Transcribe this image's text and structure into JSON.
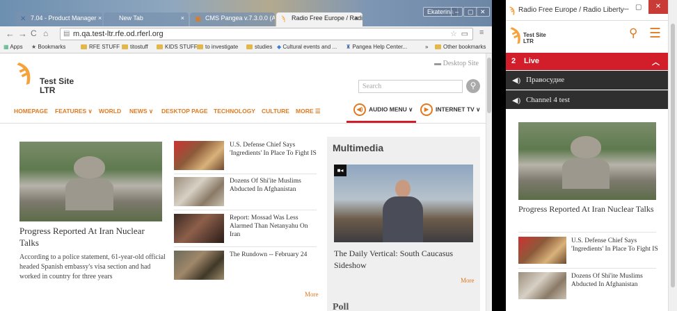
{
  "browser": {
    "tabs": [
      {
        "label": "7.04 - Product Manager ×",
        "icon": "x-icon"
      },
      {
        "label": "New Tab",
        "icon": ""
      },
      {
        "label": "CMS Pangea v.7.3.0.0 (A...",
        "icon": "cms-icon"
      },
      {
        "label": "Radio Free Europe / Radio",
        "icon": "rferl-icon"
      }
    ],
    "user_badge": "Ekaterina",
    "url": "m.qa.test-ltr.rfe.od.rferl.org",
    "bookmarks": [
      "Apps",
      "Bookmarks",
      "RFE STUFF",
      "titostuff",
      "KIDS STUFF",
      "to investigate",
      "studies",
      "Cultural events and ...",
      "Pangea Help Center...",
      "»",
      "Other bookmarks"
    ]
  },
  "site": {
    "logo_line1": "Test Site",
    "logo_line2": "LTR",
    "desktop_site": "Desktop Site",
    "search_placeholder": "Search",
    "nav": [
      "HOMEPAGE",
      "FEATURES ∨",
      "WORLD",
      "NEWS ∨",
      "DESKTOP PAGE",
      "TECHNOLOGY",
      "CULTURE",
      "MORE ☰"
    ],
    "audio_menu": "AUDIO MENU ∨",
    "internet_tv": "INTERNET TV ∨",
    "accent": "#e2791e",
    "red": "#d21e2b"
  },
  "main": {
    "lead_title": "Progress Reported At Iran Nuclear Talks",
    "lead_text": "According to a police statement, 61-year-old official headed Spanish embassy's visa section and had worked in country for three years",
    "stories": [
      "U.S. Defense Chief Says 'Ingredients' In Place To Fight IS",
      "Dozens Of Shi'ite Muslims Abducted In Afghanistan",
      "Report: Mossad Was Less Alarmed Than Netanyahu On Iran",
      "The Rundown -- February 24"
    ],
    "more_label": "More",
    "multimedia_heading": "Multimedia",
    "video_title": "The Daily Vertical: South Caucasus Sideshow",
    "poll_heading": "Poll"
  },
  "mobile": {
    "window_title": "Radio Free Europe / Radio Liberty",
    "logo_line1": "Test Site",
    "logo_line2": "LTR",
    "live_count": "2",
    "live_label": "Live",
    "channels": [
      "Правосудие",
      "Channel 4 test"
    ],
    "lead_title": "Progress Reported At Iran Nuclear Talks",
    "stories": [
      "U.S. Defense Chief Says 'Ingredients' In Place To Fight IS",
      "Dozens Of Shi'ite Muslims Abducted In Afghanistan"
    ]
  }
}
